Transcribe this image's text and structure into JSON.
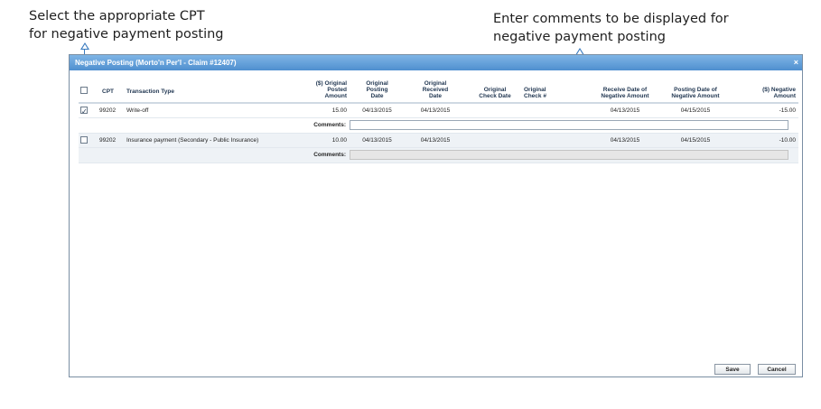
{
  "annotations": {
    "left_line1": "Select the appropriate CPT",
    "left_line2": "for negative payment posting",
    "right_line1": "Enter comments to be displayed for",
    "right_line2": "negative payment posting"
  },
  "dialog": {
    "title": "Negative Posting (Morto'n Per'l - Claim #12407)",
    "close_label": "×",
    "columns": {
      "cpt": "CPT",
      "transaction_type": "Transaction Type",
      "orig_posted_amount": [
        "($) Original",
        "Posted",
        "Amount"
      ],
      "orig_posting_date": [
        "Original",
        "Posting",
        "Date"
      ],
      "orig_received_date": [
        "Original",
        "Received",
        "Date"
      ],
      "orig_check_date": [
        "Original",
        "Check Date"
      ],
      "orig_check_no": [
        "Original",
        "Check #"
      ],
      "receive_date_neg": [
        "Receive Date of",
        "Negative Amount"
      ],
      "posting_date_neg": [
        "Posting Date of",
        "Negative Amount"
      ],
      "negative_amount": [
        "($) Negative",
        "Amount"
      ]
    },
    "rows": [
      {
        "checked": true,
        "cpt": "99202",
        "transaction_type": "Write-off",
        "orig_posted_amount": "15.00",
        "orig_posting_date": "04/13/2015",
        "orig_received_date": "04/13/2015",
        "orig_check_date": "",
        "orig_check_no": "",
        "receive_date_neg": "04/13/2015",
        "posting_date_neg": "04/15/2015",
        "negative_amount": "-15.00",
        "comments_label": "Comments:",
        "comments_value": ""
      },
      {
        "checked": false,
        "cpt": "99202",
        "transaction_type": "Insurance payment (Secondary - Public Insurance)",
        "orig_posted_amount": "10.00",
        "orig_posting_date": "04/13/2015",
        "orig_received_date": "04/13/2015",
        "orig_check_date": "",
        "orig_check_no": "",
        "receive_date_neg": "04/13/2015",
        "posting_date_neg": "04/15/2015",
        "negative_amount": "-10.00",
        "comments_label": "Comments:",
        "comments_value": ""
      }
    ],
    "buttons": {
      "save": "Save",
      "cancel": "Cancel"
    }
  },
  "colors": {
    "titlebar": "#4f8fcf",
    "arrow": "#3a7bbf",
    "header_text": "#1f3550"
  }
}
